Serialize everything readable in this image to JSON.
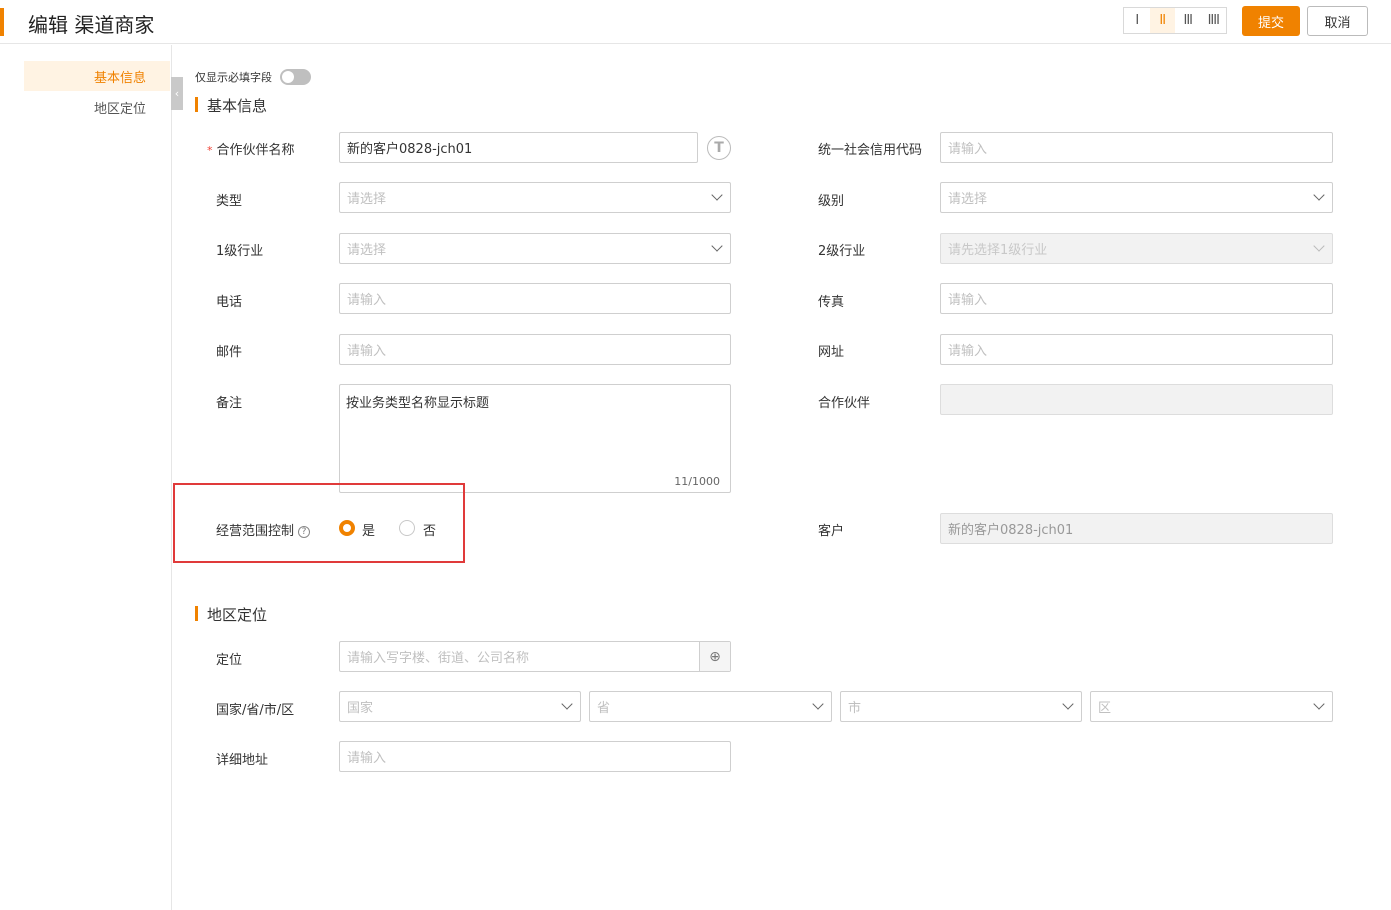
{
  "header": {
    "title": "编辑 渠道商家",
    "columns": [
      "I",
      "II",
      "III",
      "IIII"
    ],
    "submit": "提交",
    "cancel": "取消",
    "accent": "#f08200"
  },
  "sidebar": {
    "items": [
      {
        "label": "基本信息"
      },
      {
        "label": "地区定位"
      }
    ]
  },
  "toggle": {
    "label": "仅显示必填字段",
    "on": false
  },
  "basic": {
    "title": "基本信息",
    "partner_name": {
      "label": "合作伙伴名称",
      "value": "新的客户0828-jch01"
    },
    "credit_code": {
      "label": "统一社会信用代码",
      "placeholder": "请输入"
    },
    "type": {
      "label": "类型",
      "placeholder": "请选择"
    },
    "level": {
      "label": "级别",
      "placeholder": "请选择"
    },
    "industry1": {
      "label": "1级行业",
      "placeholder": "请选择"
    },
    "industry2": {
      "label": "2级行业",
      "placeholder": "请先选择1级行业"
    },
    "phone": {
      "label": "电话",
      "placeholder": "请输入"
    },
    "fax": {
      "label": "传真",
      "placeholder": "请输入"
    },
    "email": {
      "label": "邮件",
      "placeholder": "请输入"
    },
    "website": {
      "label": "网址",
      "placeholder": "请输入"
    },
    "remark": {
      "label": "备注",
      "value": "按业务类型名称显示标题",
      "count": "11/1000"
    },
    "partner": {
      "label": "合作伙伴"
    },
    "scope_control": {
      "label": "经营范围控制",
      "yes": "是",
      "no": "否",
      "selected": "是"
    },
    "customer": {
      "label": "客户",
      "value": "新的客户0828-jch01"
    }
  },
  "region": {
    "title": "地区定位",
    "locate": {
      "label": "定位",
      "placeholder": "请输入写字楼、街道、公司名称"
    },
    "area": {
      "label": "国家/省/市/区",
      "country": "国家",
      "province": "省",
      "city": "市",
      "district": "区"
    },
    "address": {
      "label": "详细地址",
      "placeholder": "请输入"
    }
  }
}
